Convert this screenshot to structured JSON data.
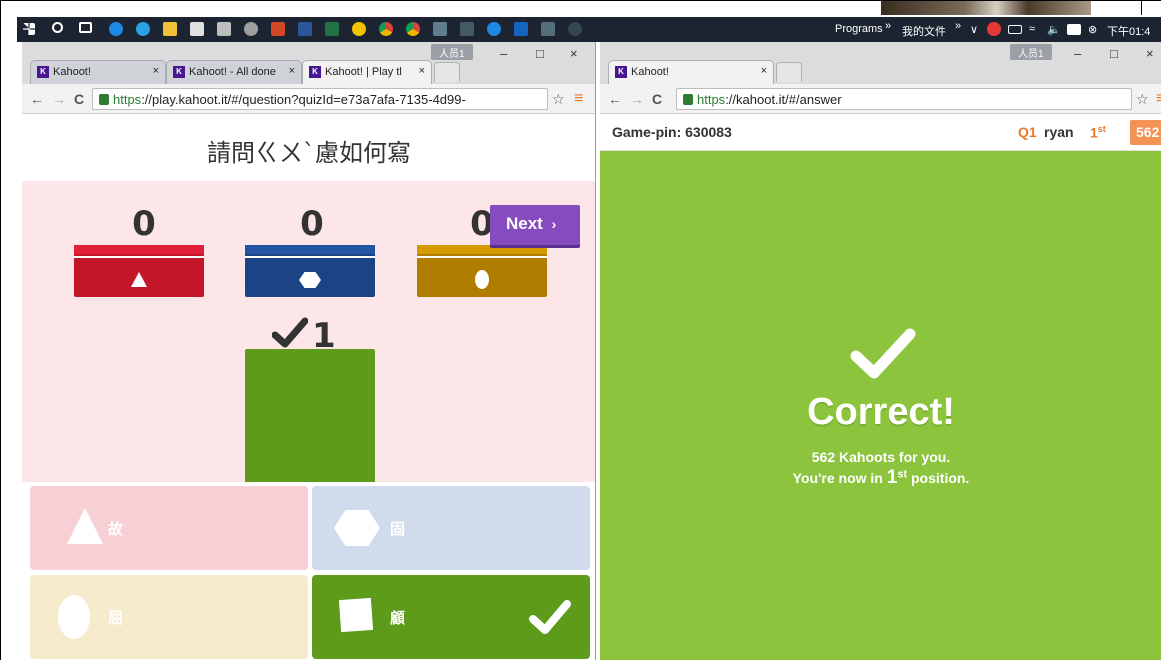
{
  "taskbar": {
    "programs_label": "Programs",
    "folder_label": "我的文件",
    "chevron": "»",
    "clock": "下午01:4",
    "icons": [
      "windows-start",
      "search",
      "task-view",
      "edge",
      "ie",
      "file-explorer",
      "store",
      "calculator",
      "media",
      "powerpoint",
      "word",
      "excel",
      "norton",
      "chrome",
      "chrome-alt",
      "app",
      "app2",
      "app3",
      "app4",
      "app5",
      "app6"
    ]
  },
  "left_window": {
    "profile": "人员1",
    "tabs": [
      {
        "label": "Kahoot!",
        "close": "×"
      },
      {
        "label": "Kahoot! - All done",
        "close": "×"
      },
      {
        "label": "Kahoot! | Play tl",
        "close": "×",
        "audio": "🔊"
      }
    ],
    "url_https": "https",
    "url_rest": "://play.kahoot.it/#/question?quizId=e73a7afa-7135-4d99-",
    "question": "請問ㄍㄨˋ慮如何寫",
    "counts": [
      "0",
      "0",
      "0"
    ],
    "next_label": "Next",
    "next_arrow": "›",
    "correct_count": "1",
    "answers": [
      {
        "label": "故",
        "shape": "triangle",
        "color": "#f7d0d5"
      },
      {
        "label": "固",
        "shape": "hexagon",
        "color": "#d0dceb"
      },
      {
        "label": "屈",
        "shape": "ellipse",
        "color": "#f7ebcd"
      },
      {
        "label": "顧",
        "shape": "square",
        "color": "#5e9b1b",
        "correct": true
      }
    ],
    "colors": {
      "red": "#c4162a",
      "blue": "#1c4385",
      "yellow": "#b07d00",
      "green": "#5e9b1b"
    }
  },
  "right_window": {
    "profile": "人员1",
    "tab_label": "Kahoot!",
    "tab_close": "×",
    "url_https": "https",
    "url_rest": "://kahoot.it/#/answer",
    "game_pin": "Game-pin: 630083",
    "question_num": "Q1",
    "player": "ryan",
    "rank": "1",
    "rank_suffix": "st",
    "score": "562",
    "result_title": "Correct!",
    "result_line1": "562 Kahoots for you.",
    "result_line2_pre": "You're now in ",
    "result_line2_rank": "1",
    "result_line2_suffix": "st",
    "result_line2_post": " position.",
    "bg_color": "#8cc43d"
  },
  "window_controls": {
    "minimize": "–",
    "maximize": "□",
    "close": "×"
  },
  "nav": {
    "back": "←",
    "forward": "→",
    "reload": "C",
    "menu": "≡",
    "star": "☆"
  }
}
